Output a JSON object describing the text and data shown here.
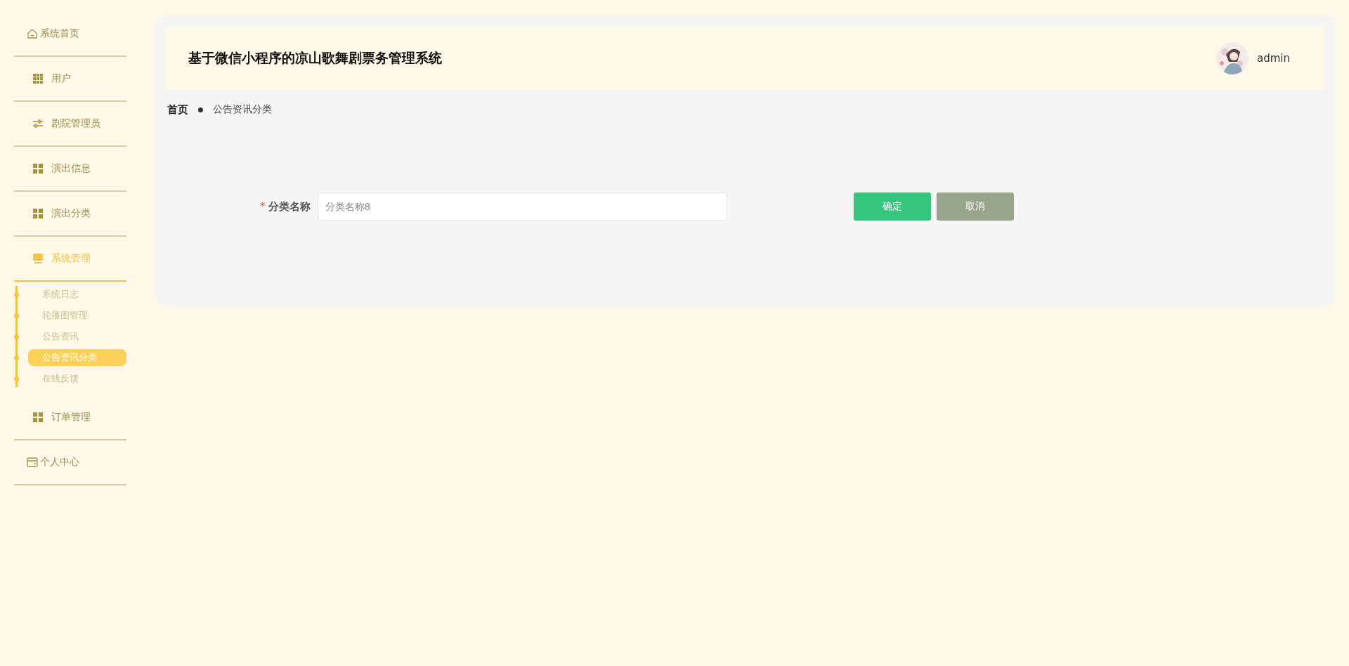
{
  "sidebar": {
    "items": [
      {
        "label": "系统首页",
        "kind": "link",
        "expanded": false
      },
      {
        "label": "用户",
        "kind": "menu",
        "expanded": false
      },
      {
        "label": "剧院管理员",
        "kind": "menu",
        "expanded": false
      },
      {
        "label": "演出信息",
        "kind": "menu",
        "expanded": false
      },
      {
        "label": "演出分类",
        "kind": "menu",
        "expanded": false
      },
      {
        "label": "系统管理",
        "kind": "menu",
        "expanded": true,
        "children": [
          {
            "label": "系统日志",
            "selected": false
          },
          {
            "label": "轮播图管理",
            "selected": false
          },
          {
            "label": "公告资讯",
            "selected": false
          },
          {
            "label": "公告资讯分类",
            "selected": true
          },
          {
            "label": "在线反馈",
            "selected": false
          }
        ]
      },
      {
        "label": "订单管理",
        "kind": "menu",
        "expanded": false
      },
      {
        "label": "个人中心",
        "kind": "link",
        "expanded": false
      }
    ]
  },
  "header": {
    "title": "基于微信小程序的凉山歌舞剧票务管理系统",
    "user": "admin"
  },
  "breadcrumb": [
    "首页",
    "公告资讯分类"
  ],
  "form": {
    "fields": [
      {
        "label": "分类名称",
        "required_mark": "*",
        "placeholder": "分类名称8"
      }
    ],
    "buttons": [
      {
        "label": "确定",
        "kind": "primary"
      },
      {
        "label": "取消",
        "kind": "cancel"
      }
    ]
  }
}
